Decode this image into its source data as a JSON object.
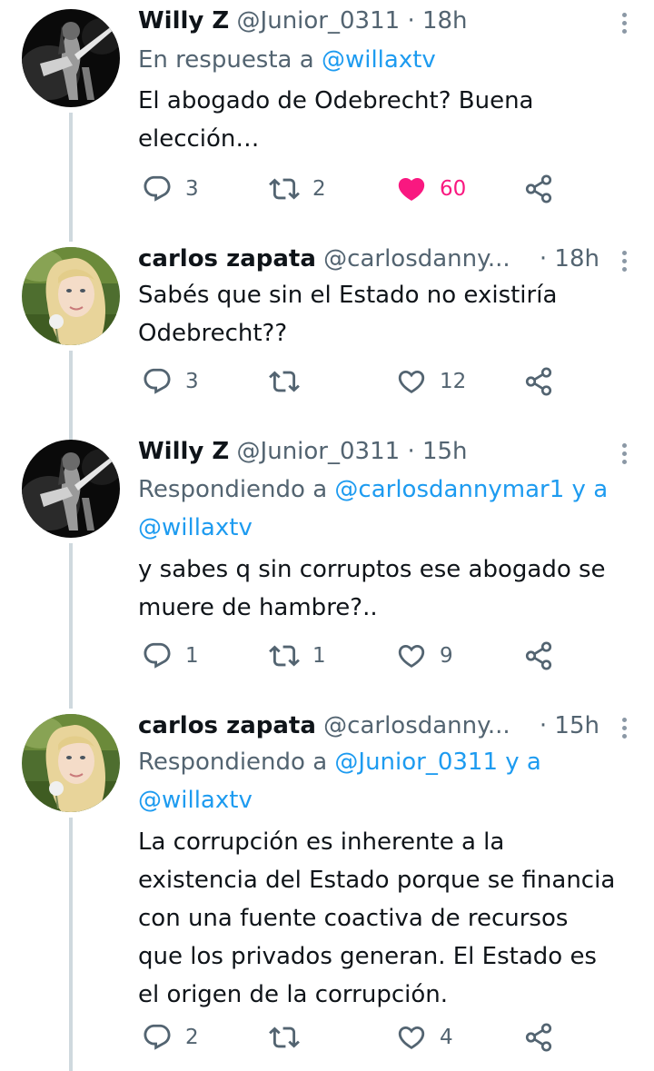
{
  "tweets": [
    {
      "name": "Willy Z",
      "handle": "@Junior_0311",
      "sep": "·",
      "time": "18h",
      "reply_prefix": "En respuesta a ",
      "reply_mention": "@willaxtv",
      "reply_mention2": "",
      "lines": [
        "El abogado de Odebrecht? Buena",
        "elección…"
      ],
      "counts": {
        "reply": "3",
        "retweet": "2",
        "like": "60"
      },
      "liked": true,
      "avatar_icon": "guitarist-avatar"
    },
    {
      "name": "carlos zapata",
      "handle": "@carlosdanny...",
      "sep": "·",
      "time": "18h",
      "lines": [
        "Sabés que sin el Estado no existiría",
        "Odebrecht??"
      ],
      "counts": {
        "reply": "3",
        "retweet": "",
        "like": "12"
      },
      "liked": false,
      "avatar_icon": "blonde-girl-avatar"
    },
    {
      "name": "Willy Z",
      "handle": "@Junior_0311",
      "sep": "·",
      "time": "15h",
      "reply_prefix": "Respondiendo a ",
      "reply_mention": "@carlosdannymar1 y a",
      "reply_mention2": "@willaxtv",
      "lines": [
        "y sabes q sin corruptos ese abogado se",
        "muere de hambre?.."
      ],
      "counts": {
        "reply": "1",
        "retweet": "1",
        "like": "9"
      },
      "liked": false,
      "avatar_icon": "guitarist-avatar"
    },
    {
      "name": "carlos zapata",
      "handle": "@carlosdanny...",
      "sep": "·",
      "time": "15h",
      "reply_prefix": "Respondiendo a ",
      "reply_mention": "@Junior_0311 y a",
      "reply_mention2": "@willaxtv",
      "lines": [
        "La corrupción es inherente a la",
        "existencia del Estado porque se financia",
        "con una fuente coactiva de recursos",
        "que los privados generan. El Estado es",
        "el origen de la corrupción."
      ],
      "counts": {
        "reply": "2",
        "retweet": "",
        "like": "4"
      },
      "liked": false,
      "avatar_icon": "blonde-girl-avatar"
    }
  ],
  "colors": {
    "text": "#0f1419",
    "secondary": "#536471",
    "link": "#1d9bf0",
    "like_active": "#f91880",
    "thread_line": "#cfd9de"
  }
}
